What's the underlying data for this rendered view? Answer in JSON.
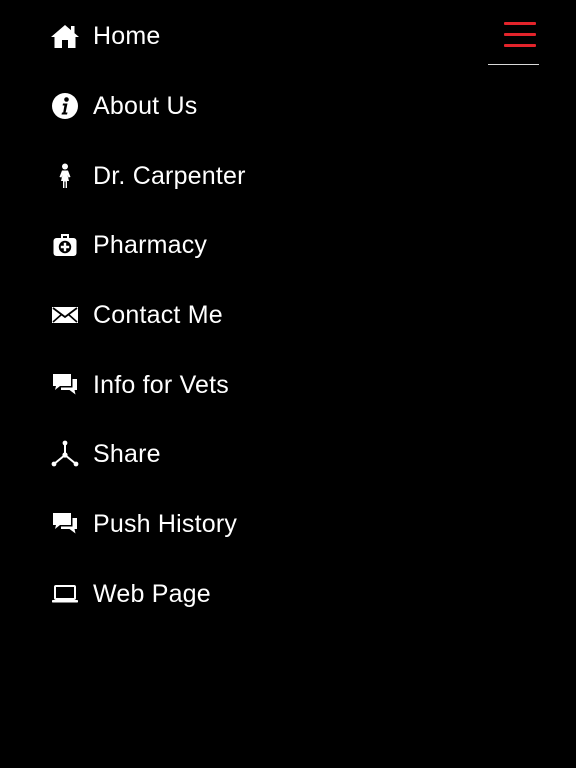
{
  "colors": {
    "background": "#000000",
    "text": "#ffffff",
    "accent": "#e3242b"
  },
  "menu_toggle": {
    "icon": "hamburger-menu-icon"
  },
  "nav": {
    "items": [
      {
        "label": "Home",
        "icon": "home-icon"
      },
      {
        "label": "About Us",
        "icon": "info-icon"
      },
      {
        "label": "Dr. Carpenter",
        "icon": "person-icon"
      },
      {
        "label": "Pharmacy",
        "icon": "medical-bag-icon"
      },
      {
        "label": "Contact Me",
        "icon": "envelope-icon"
      },
      {
        "label": "Info for Vets",
        "icon": "chat-bubbles-icon"
      },
      {
        "label": "Share",
        "icon": "share-icon"
      },
      {
        "label": "Push History",
        "icon": "chat-bubbles-icon"
      },
      {
        "label": "Web Page",
        "icon": "laptop-icon"
      }
    ]
  }
}
